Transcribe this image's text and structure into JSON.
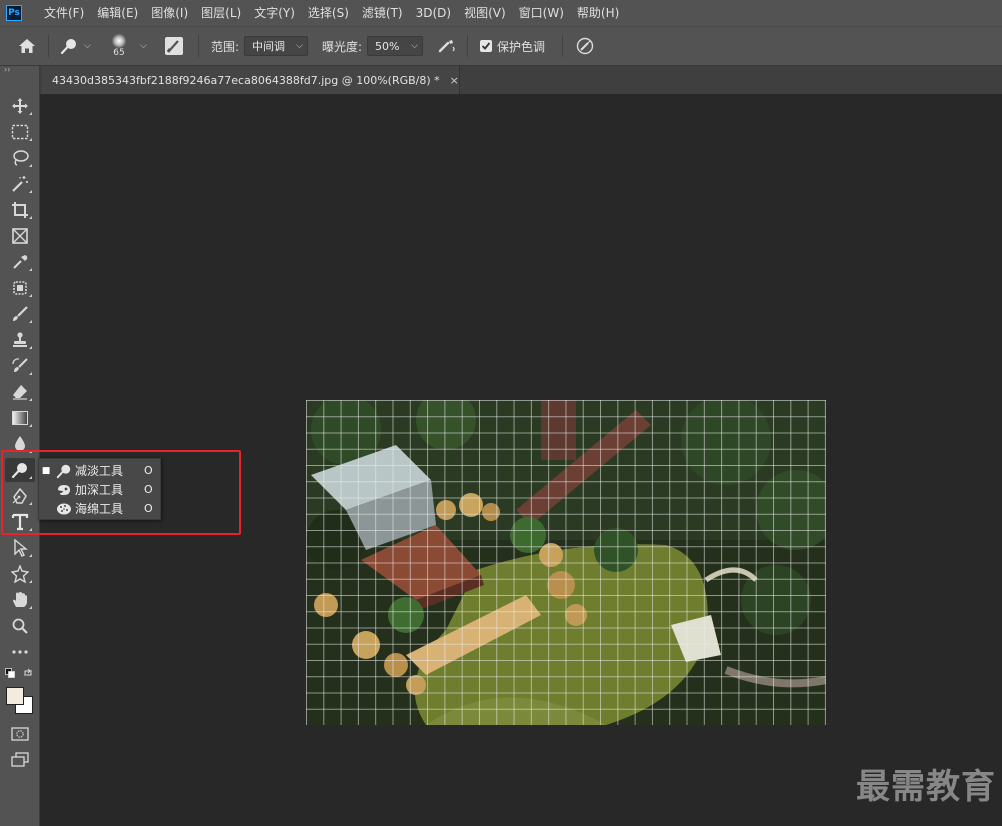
{
  "app": {
    "logo": "Ps"
  },
  "menu": [
    "文件(F)",
    "编辑(E)",
    "图像(I)",
    "图层(L)",
    "文字(Y)",
    "选择(S)",
    "滤镜(T)",
    "3D(D)",
    "视图(V)",
    "窗口(W)",
    "帮助(H)"
  ],
  "options": {
    "brush_size": "65",
    "range_label": "范围:",
    "range_value": "中间调",
    "exposure_label": "曝光度:",
    "exposure_value": "50%",
    "protect_tones_label": "保护色调",
    "protect_tones_checked": true
  },
  "document": {
    "tab_title": "43430d385343fbf2188f9246a77eca8064388fd7.jpg @ 100%(RGB/8) *",
    "close_glyph": "×"
  },
  "flyout": {
    "items": [
      {
        "name": "减淡工具",
        "shortcut": "O",
        "selected": true,
        "icon": "dodge-icon"
      },
      {
        "name": "加深工具",
        "shortcut": "O",
        "selected": false,
        "icon": "burn-icon"
      },
      {
        "name": "海绵工具",
        "shortcut": "O",
        "selected": false,
        "icon": "sponge-icon"
      }
    ],
    "selected_mark": "■"
  },
  "colors": {
    "highlight_box": "#e8232a",
    "foreground": "#f2ebe0",
    "background": "#ffffff"
  },
  "watermark": "最需教育"
}
